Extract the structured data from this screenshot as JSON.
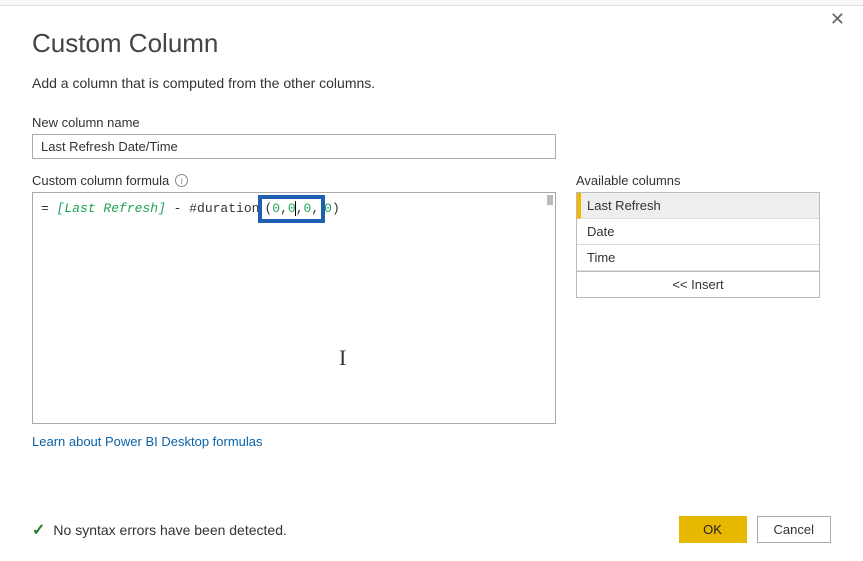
{
  "dialog": {
    "title": "Custom Column",
    "subtitle": "Add a column that is computed from the other columns.",
    "close_glyph": "✕"
  },
  "name_field": {
    "label": "New column name",
    "value": "Last Refresh Date/Time"
  },
  "formula_field": {
    "label": "Custom column formula",
    "info_glyph": "i",
    "prefix": "= ",
    "col_ref": "[Last Refresh]",
    "middle": " - #duration",
    "open_paren": "(",
    "arg1": "0",
    "comma1": ",",
    "arg2": "0",
    "comma2": ",",
    "arg3": "0",
    "comma3": ",",
    "arg4": "0",
    "close_paren": ")"
  },
  "available": {
    "label": "Available columns",
    "items": [
      "Last Refresh",
      "Date",
      "Time"
    ],
    "insert_label": "<< Insert"
  },
  "link": {
    "text": "Learn about Power BI Desktop formulas"
  },
  "status": {
    "check_glyph": "✓",
    "text": "No syntax errors have been detected."
  },
  "buttons": {
    "ok": "OK",
    "cancel": "Cancel"
  }
}
